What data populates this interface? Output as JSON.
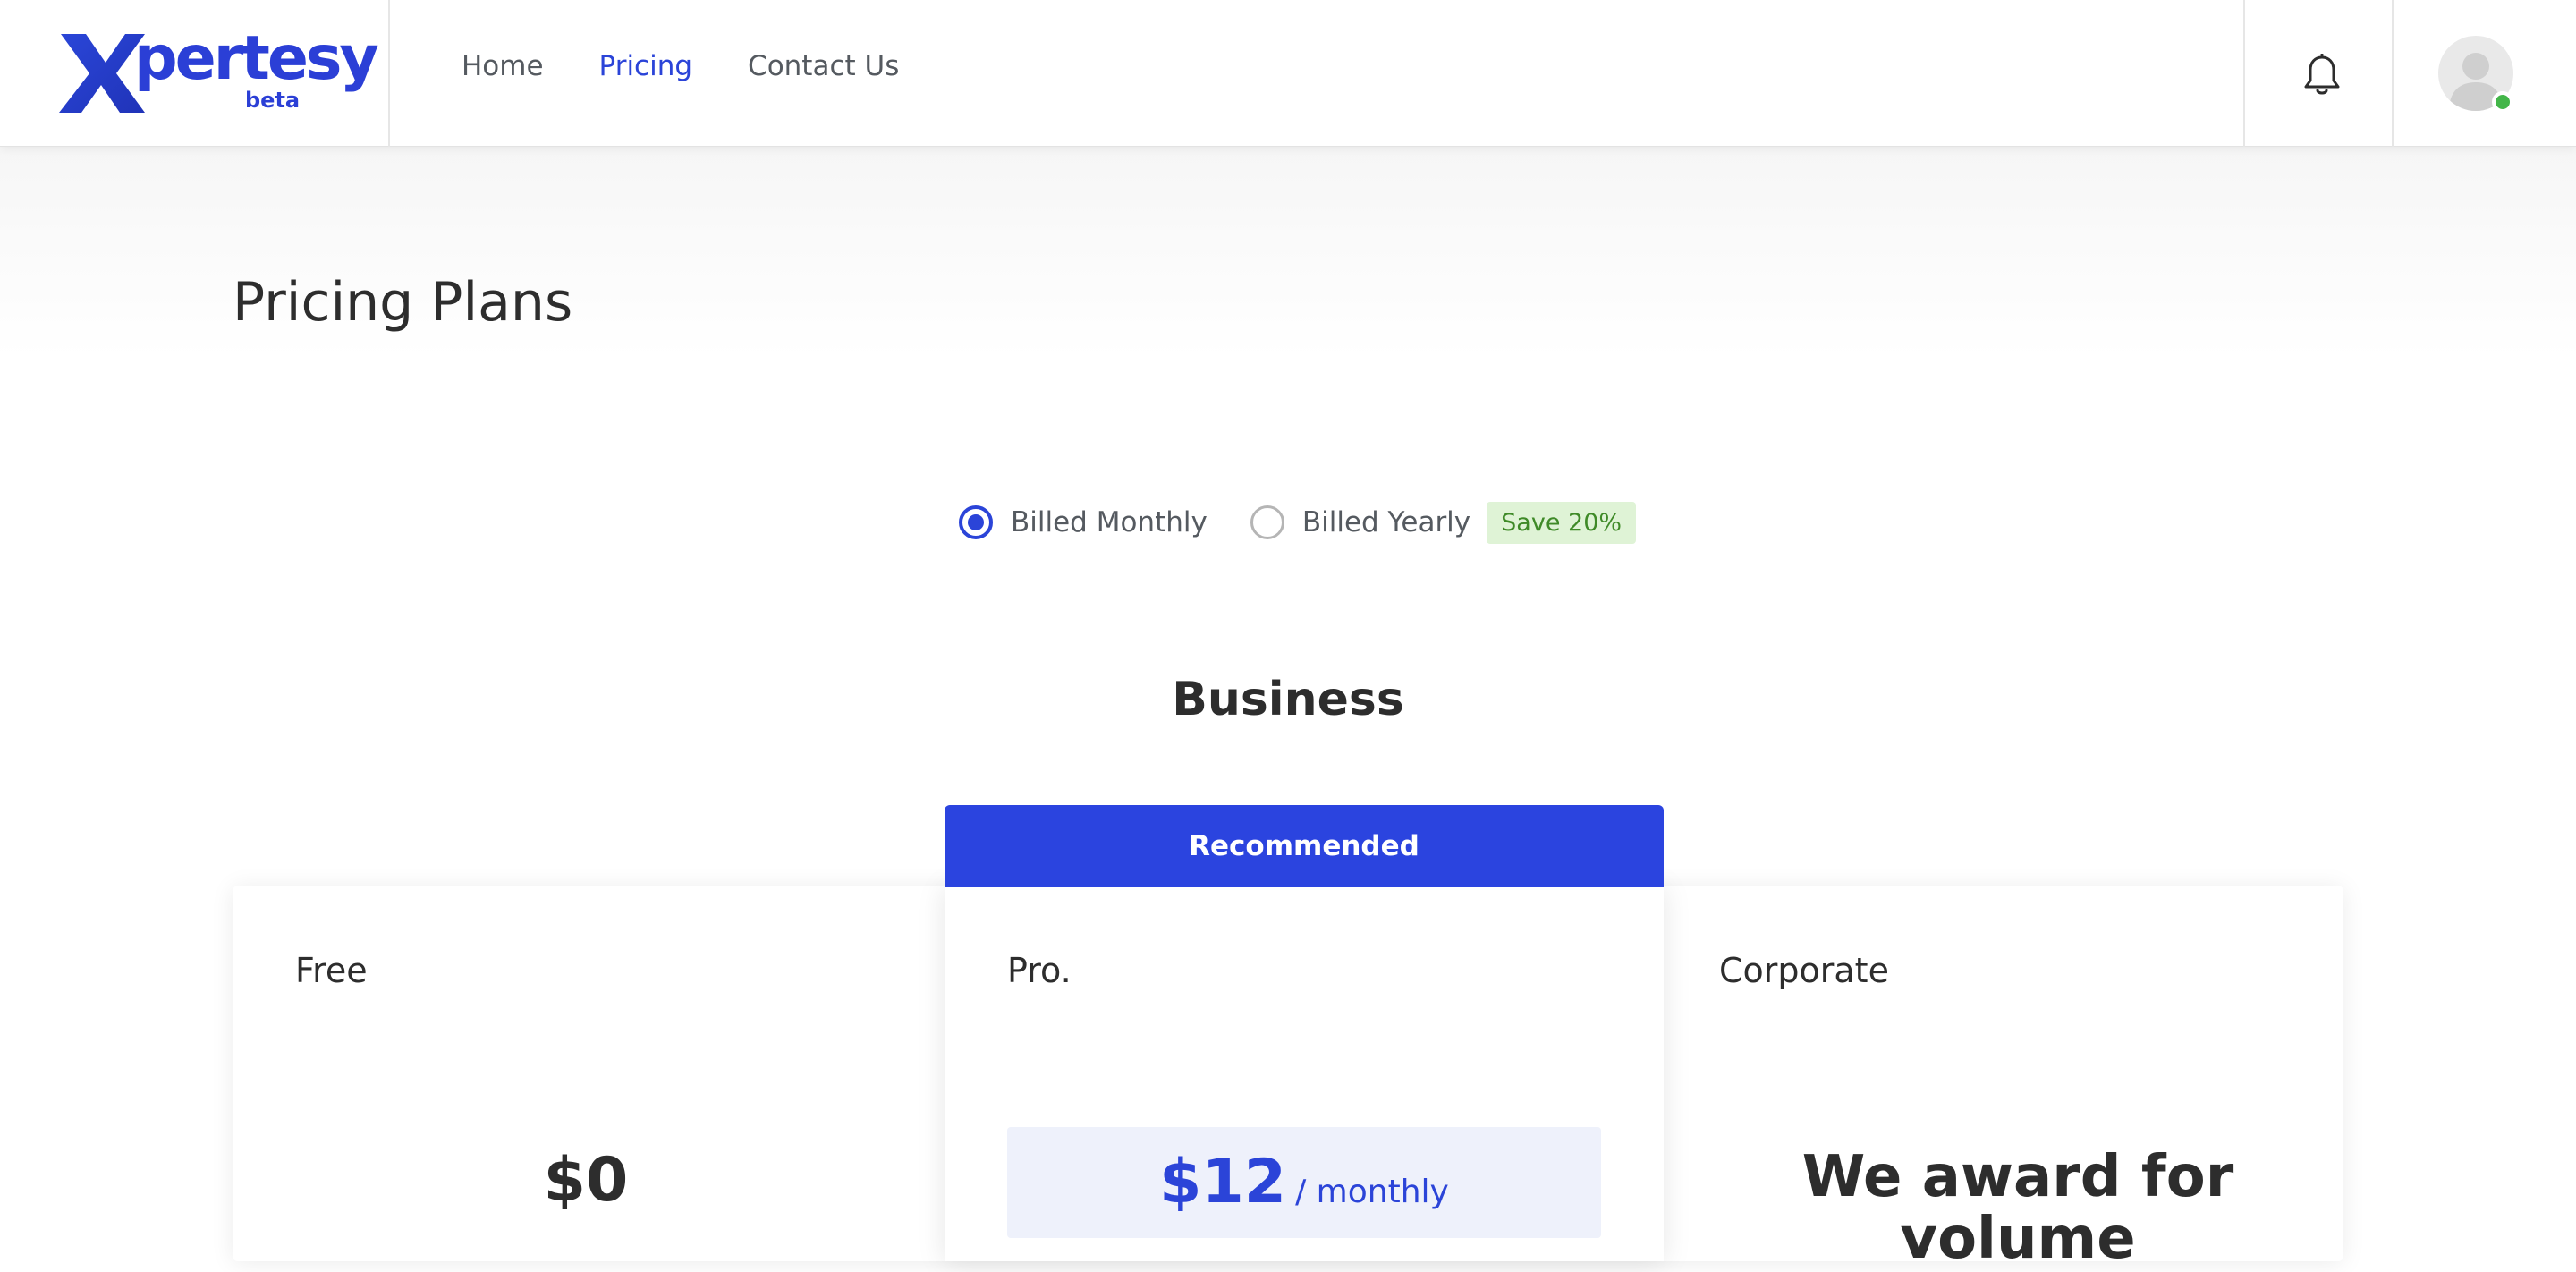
{
  "brand": {
    "name": "pertesy",
    "beta": "beta",
    "color": "#2b44d8"
  },
  "nav": {
    "items": [
      {
        "label": "Home",
        "active": false
      },
      {
        "label": "Pricing",
        "active": true
      },
      {
        "label": "Contact Us",
        "active": false
      }
    ]
  },
  "header": {
    "bell_icon": "bell-icon",
    "avatar_icon": "user-avatar-icon",
    "online_color": "#43b649"
  },
  "page": {
    "title": "Pricing Plans"
  },
  "billing": {
    "monthly_label": "Billed Monthly",
    "yearly_label": "Billed Yearly",
    "save_badge": "Save 20%",
    "selected": "monthly"
  },
  "section": {
    "title": "Business"
  },
  "plans": {
    "recommended_label": "Recommended",
    "free": {
      "name": "Free",
      "price": "$0"
    },
    "pro": {
      "name": "Pro.",
      "price": "$12",
      "period": "/ monthly"
    },
    "corporate": {
      "name": "Corporate",
      "text": "We award for volume"
    }
  },
  "colors": {
    "accent": "#2b44d8",
    "badge_bg": "#dff3d6",
    "badge_text": "#3f8a28",
    "price_box_bg": "#eef1fb"
  }
}
